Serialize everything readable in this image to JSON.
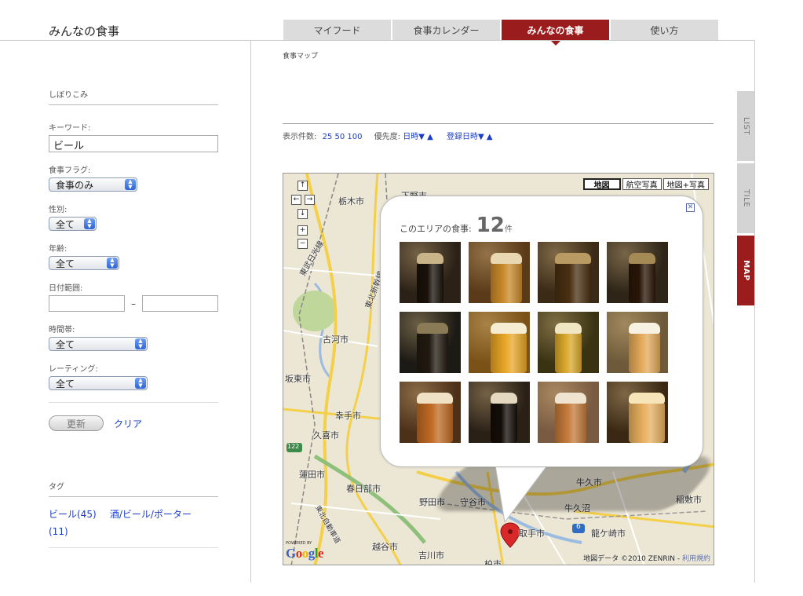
{
  "site": {
    "title": "みんなの食事"
  },
  "tabs": [
    {
      "label": "マイフード",
      "active": false
    },
    {
      "label": "食事カレンダー",
      "active": false
    },
    {
      "label": "みんなの食事",
      "active": true
    },
    {
      "label": "使い方",
      "active": false
    }
  ],
  "sidebar": {
    "filter_heading": "しぼりこみ",
    "keyword_label": "キーワード:",
    "keyword_value": "ビール",
    "flag_label": "食事フラグ:",
    "flag_value": "食事のみ",
    "gender_label": "性別:",
    "gender_value": "全て",
    "age_label": "年齢:",
    "age_value": "全て",
    "date_label": "日付範囲:",
    "date_sep": "–",
    "time_label": "時間帯:",
    "time_value": "全て",
    "rating_label": "レーティング:",
    "rating_value": "全て",
    "update_button": "更新",
    "clear_link": "クリア",
    "tag_heading": "タグ",
    "tags": [
      "ビール(45)",
      "酒/ビール/ポーター(11)"
    ]
  },
  "main": {
    "map_title": "食事マップ",
    "display_count_label": "表示件数:",
    "display_counts": [
      "25",
      "50",
      "100"
    ],
    "priority_label": "優先度:",
    "sort_datetime": "日時▼",
    "sort_reg": "登録日時▼",
    "sort_up": "▲"
  },
  "side_tabs": [
    {
      "label": "LIST",
      "active": false
    },
    {
      "label": "TILE",
      "active": false
    },
    {
      "label": "MAP",
      "active": true
    }
  ],
  "map": {
    "types": [
      {
        "label": "地図",
        "active": true
      },
      {
        "label": "航空写真",
        "active": false
      },
      {
        "label": "地図+写真",
        "active": false
      }
    ],
    "nav": {
      "up": "↑",
      "left": "←",
      "right": "→",
      "down": "↓",
      "zoom_in": "+",
      "zoom_out": "−"
    },
    "labels": {
      "tochigi": "栃木市",
      "shimotsuma": "下野市",
      "koga": "古河市",
      "satte": "幸手市",
      "kuki": "久喜市",
      "hasuda": "蓮田市",
      "kasukabe": "春日部市",
      "noda": "野田市",
      "moriya": "守谷市",
      "koshigaya": "越谷市",
      "yoshikawa": "吉川市",
      "toride": "取手市",
      "ushiku": "牛久市",
      "ushikunuma": "牛久沼",
      "ryugasaki": "龍ケ崎市",
      "inashiki": "稲敷市",
      "tobu": "東武日光線",
      "tohoku": "東北新幹線",
      "tohokuexp": "東北自動車道",
      "kashiwa": "柏市",
      "bando": "坂東市",
      "route122": "122",
      "route6": "6"
    },
    "powered_by": "POWERED BY",
    "copyright": "地図データ ©2010 ZENRIN -",
    "terms": "利用規約"
  },
  "popup": {
    "title": "このエリアの食事:",
    "count": "12",
    "unit": "件",
    "close": "✕"
  },
  "thumbs": [
    {
      "name": "dark-stout-bottle",
      "bg": "#2b2116",
      "glass": "#1a120a",
      "foam": "#c9b48a"
    },
    {
      "name": "amber-pint-bottles",
      "bg": "#5a3a18",
      "glass": "#c98a2a",
      "foam": "#e8d7b0"
    },
    {
      "name": "dark-bottles-chimay",
      "bg": "#3a2a16",
      "glass": "#4a2f12",
      "foam": "#b89a62"
    },
    {
      "name": "dark-ale-goblet",
      "bg": "#2e2518",
      "glass": "#2a1608",
      "foam": "#a68a55"
    },
    {
      "name": "dark-bottle-glass",
      "bg": "#1c1a14",
      "glass": "#221a10",
      "foam": "#8a7a55"
    },
    {
      "name": "lager-mug",
      "bg": "#7a5218",
      "glass": "#e8a626",
      "foam": "#f5ecd2"
    },
    {
      "name": "kirin-lager",
      "bg": "#3a3312",
      "glass": "#d9a82a",
      "foam": "#f0e6c4"
    },
    {
      "name": "hefeweizen-glass",
      "bg": "#6e5a3a",
      "glass": "#e3a95a",
      "foam": "#f7f1e2"
    },
    {
      "name": "amber-ale-glass",
      "bg": "#4c3018",
      "glass": "#c06a24",
      "foam": "#efe2c4"
    },
    {
      "name": "guinness-pint",
      "bg": "#2a2016",
      "glass": "#140d08",
      "foam": "#e4d9c0"
    },
    {
      "name": "bottles-on-table",
      "bg": "#7a5a40",
      "glass": "#c47a3a",
      "foam": "#f0e4d0"
    },
    {
      "name": "bottle-candlelight",
      "bg": "#3a2814",
      "glass": "#e8b060",
      "foam": "#f7e4b8"
    }
  ]
}
